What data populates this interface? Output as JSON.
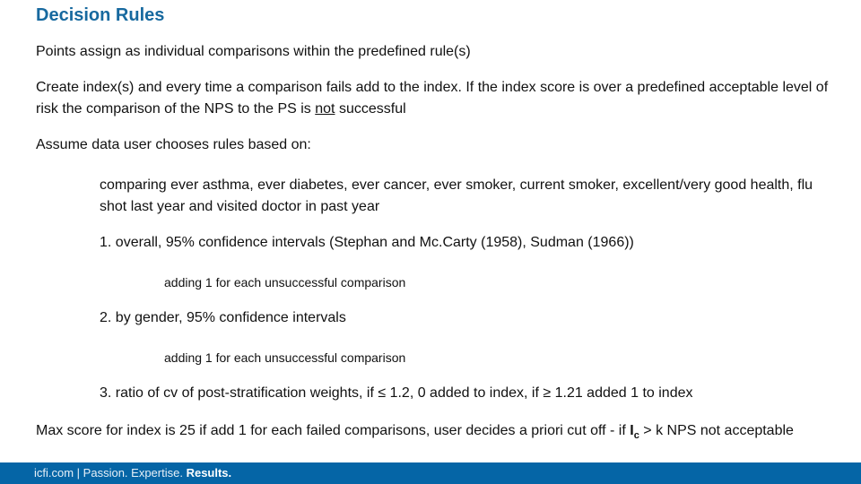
{
  "slide": {
    "title": "Decision Rules",
    "points": "Points assign as individual comparisons within  the  predefined rule(s)",
    "index_para": {
      "before": "Create index(s) and every time a comparison fails add to the index.  If the index score is over a predefined acceptable level of risk the comparison of the NPS to the PS is ",
      "underlined": "not",
      "after": " successful"
    },
    "assume": "Assume data user chooses rules based on:",
    "comparing": "comparing ever asthma, ever diabetes, ever cancer, ever smoker, current smoker, excellent/very good health, flu shot last year and visited doctor in past year",
    "rule1": "1. overall, 95% confidence intervals (Stephan and Mc.Carty (1958), Sudman (1966))",
    "rule1_sub": "adding 1 for each unsuccessful comparison",
    "rule2": "2. by gender, 95% confidence intervals",
    "rule2_sub": "adding 1 for each unsuccessful comparison",
    "rule3": "3. ratio of cv of post-stratification weights, if ≤ 1.2, 0 added to index, if ≥ 1.21 added 1 to index",
    "max_score": {
      "before": "Max score for  index is 25 if add 1 for each failed comparisons, user decides  a priori cut off - if ",
      "symbol": "I",
      "subscript": "c",
      "after": " > k NPS not acceptable"
    }
  },
  "footer": {
    "site": "icfi.com",
    "separator": " | ",
    "tag1": "Passion.",
    "tag2": " Expertise.",
    "tag3": " Results."
  }
}
